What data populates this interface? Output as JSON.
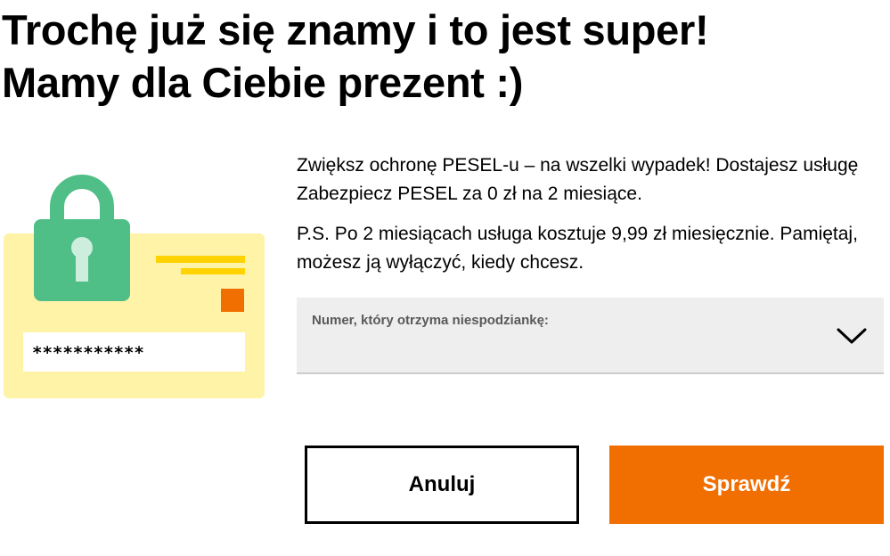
{
  "headline": {
    "line1": "Trochę już się znamy i to jest super!",
    "line2": "Mamy dla Ciebie prezent :)"
  },
  "illustration": {
    "masked_value": "***********",
    "icon": "padlock-id-card-icon",
    "colors": {
      "card": "#fff3a8",
      "lock": "#50be87",
      "stripe": "#ffd200",
      "square": "#f16e00"
    }
  },
  "description": {
    "paragraph1": "Zwiększ ochronę PESEL-u – na wszelki wypadek! Dostajesz usługę Zabezpiecz PESEL za 0 zł na 2 miesiące.",
    "paragraph2": "P.S. Po 2 miesiącach usługa kosztuje 9,99 zł miesięcznie. Pamiętaj, możesz ją wyłączyć, kiedy chcesz."
  },
  "number_select": {
    "label": "Numer, który otrzyma niespodziankę:",
    "icon": "chevron-down-icon"
  },
  "actions": {
    "cancel_label": "Anuluj",
    "confirm_label": "Sprawdź"
  },
  "colors": {
    "accent": "#f16e00",
    "field_background": "#eeeeee"
  }
}
